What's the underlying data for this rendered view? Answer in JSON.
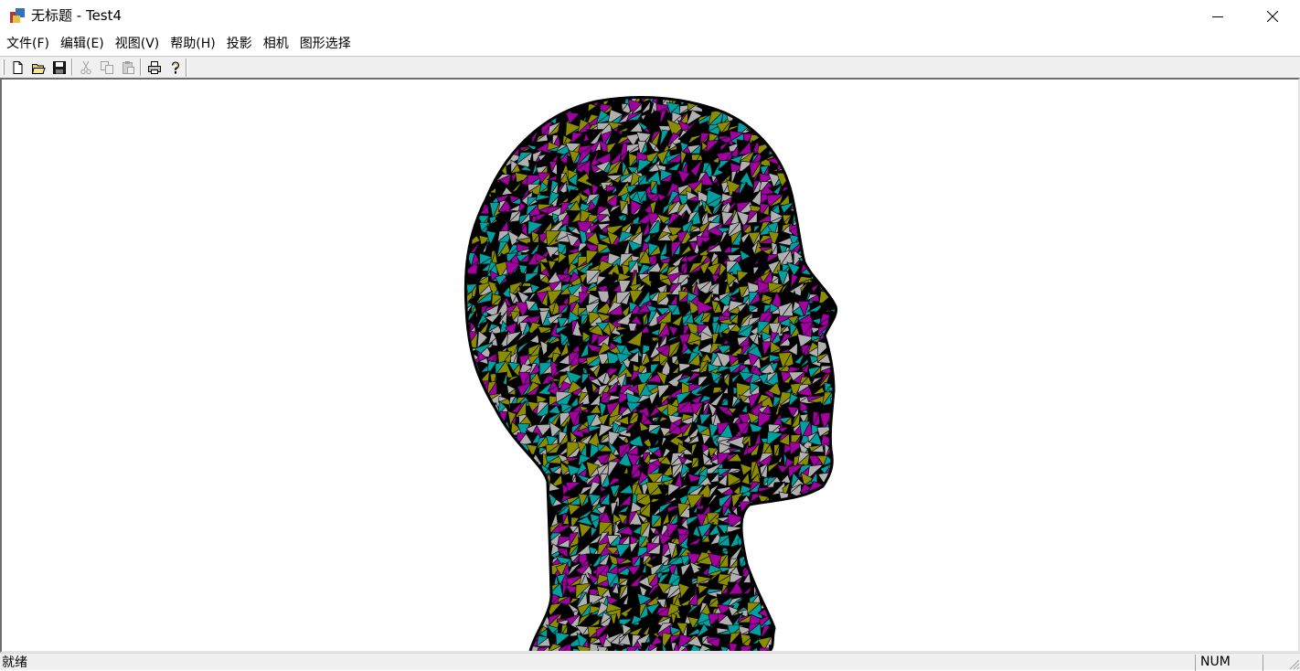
{
  "window": {
    "title": "无标题 - Test4"
  },
  "menu": [
    {
      "label": "文件(F)"
    },
    {
      "label": "编辑(E)"
    },
    {
      "label": "视图(V)"
    },
    {
      "label": "帮助(H)"
    },
    {
      "label": "投影"
    },
    {
      "label": "相机"
    },
    {
      "label": "图形选择"
    }
  ],
  "toolbar": {
    "buttons": [
      {
        "icon": "new-file-icon",
        "enabled": true
      },
      {
        "icon": "open-folder-icon",
        "enabled": true
      },
      {
        "icon": "save-icon",
        "enabled": true
      },
      {
        "icon": "cut-icon",
        "enabled": false
      },
      {
        "icon": "copy-icon",
        "enabled": false
      },
      {
        "icon": "paste-icon",
        "enabled": false
      },
      {
        "icon": "print-icon",
        "enabled": true
      },
      {
        "icon": "help-icon",
        "enabled": true
      }
    ]
  },
  "render": {
    "palette": [
      "#8c8c00",
      "#00a0a0",
      "#a000a0",
      "#000000",
      "#b0b0b0"
    ]
  },
  "status": {
    "text": "就绪",
    "num": "NUM"
  }
}
